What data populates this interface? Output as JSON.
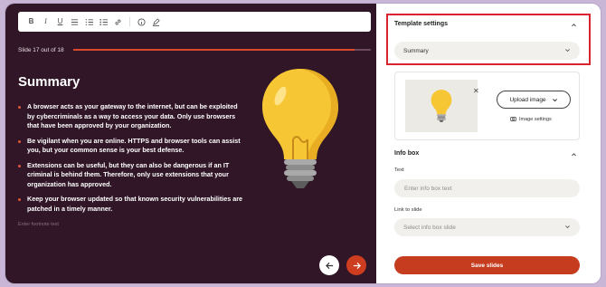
{
  "toolbar": {
    "bold_label": "B",
    "italic_label": "I",
    "underline_label": "U",
    "icons": [
      "bold-icon",
      "italic-icon",
      "underline-icon",
      "align-icon",
      "ordered-list-icon",
      "bullet-list-icon",
      "link-icon",
      "info-icon",
      "pen-icon"
    ]
  },
  "slide": {
    "counter": "Slide 17 out of 18",
    "progress": 0.944,
    "title": "Summary",
    "bullets": [
      "A browser acts as your gateway to the internet, but can be exploited by cybercriminals as a way to access your data. Only use browsers that have been approved by your organization.",
      "Be vigilant when you are online. HTTPS and browser tools can assist you, but your common sense is your best defense.",
      "Extensions can be useful, but they can also be dangerous if an IT criminal is behind them. Therefore, only use extensions that your organization has approved.",
      "Keep your browser updated so that known security vulnerabilities are patched in a timely manner."
    ],
    "footnote_placeholder": "Enter footnote text",
    "prev_icon": "arrow-left-icon",
    "next_icon": "arrow-right-icon"
  },
  "panel": {
    "template_settings": {
      "heading": "Template settings",
      "selected_template": "Summary"
    },
    "image": {
      "upload_label": "Upload image",
      "settings_label": "Image settings"
    },
    "info_box": {
      "heading": "Info box",
      "text_label": "Text",
      "text_placeholder": "Enter info box text",
      "link_label": "Link to slide",
      "link_placeholder": "Select info box slide"
    },
    "save_label": "Save slides"
  },
  "colors": {
    "editor_bg": "#301626",
    "accent": "#c53c1f",
    "highlight": "#d9232e",
    "bulb": "#f6c634"
  }
}
